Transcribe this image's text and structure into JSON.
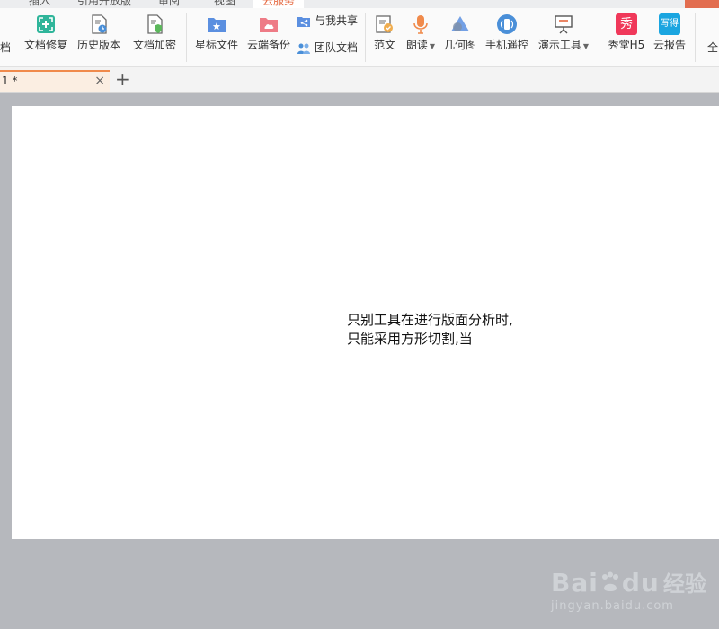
{
  "menu_tabs": [
    {
      "label": "插入"
    },
    {
      "label": "引用开放版"
    },
    {
      "label": "审阅"
    },
    {
      "label": "视图"
    },
    {
      "label": "云服务"
    }
  ],
  "ribbon": {
    "partial_left_label": "档",
    "items": [
      {
        "label": "文档修复",
        "icon": "doc-repair-icon"
      },
      {
        "label": "历史版本",
        "icon": "history-icon"
      },
      {
        "label": "文档加密",
        "icon": "doc-encrypt-icon"
      },
      {
        "label": "星标文件",
        "icon": "star-folder-icon"
      },
      {
        "label": "云端备份",
        "icon": "cloud-backup-icon"
      },
      {
        "label": "与我共享",
        "icon": "share-icon"
      },
      {
        "label": "团队文档",
        "icon": "team-icon"
      },
      {
        "label": "范文",
        "icon": "template-icon"
      },
      {
        "label": "朗读",
        "icon": "microphone-icon"
      },
      {
        "label": "几何图",
        "icon": "geometry-icon"
      },
      {
        "label": "手机遥控",
        "icon": "phone-remote-icon"
      },
      {
        "label": "演示工具",
        "icon": "presentation-icon"
      },
      {
        "label": "秀堂H5",
        "icon": "xiutang-icon"
      },
      {
        "label": "云报告",
        "icon": "cloud-report-icon"
      },
      {
        "label": "全",
        "icon": ""
      }
    ],
    "badges": {
      "xiu": "秀",
      "xiede": "写得"
    }
  },
  "doc_tab": {
    "title": "1 *",
    "close": "×",
    "add": "+"
  },
  "document": {
    "text": "只别工具在进行版面分析时,只能采用方形切割,当"
  },
  "watermark": {
    "brand": "Bai",
    "brand2": "du",
    "cn": "经验",
    "url": "jingyan.baidu.com"
  },
  "colors": {
    "accent": "#e5673f",
    "tab_highlight": "#f08a4b"
  }
}
